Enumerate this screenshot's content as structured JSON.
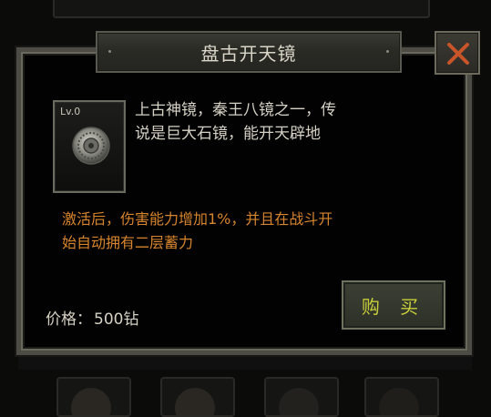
{
  "dialog": {
    "title": "盘古开天镜",
    "item": {
      "level": "Lv.0",
      "icon": "bronze-mirror-icon"
    },
    "description": [
      "上古神镜，秦王八镜之一，传",
      "说是巨大石镜，能开天辟地"
    ],
    "effect": [
      "激活后，伤害能力增加1%，并且在战斗开",
      "始自动拥有二层蓄力"
    ],
    "price_label": "价格：",
    "price_value": "500钻",
    "buy_label": "购 买",
    "close_icon": "close-icon"
  },
  "colors": {
    "effect_text": "#d7852e",
    "buy_text": "#c9cf3a",
    "close_x": "#c8552a"
  }
}
